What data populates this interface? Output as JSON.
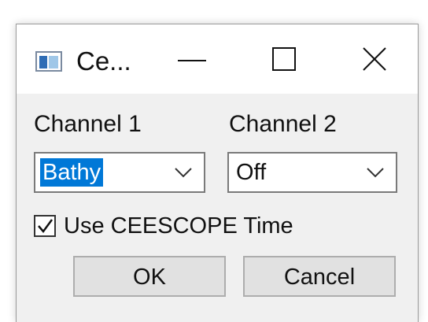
{
  "window": {
    "title": "Ce...",
    "app_icon": "window-app-icon",
    "controls": {
      "minimize_icon": "minimize-icon",
      "maximize_icon": "maximize-icon",
      "close_icon": "close-icon"
    }
  },
  "channel1": {
    "label": "Channel 1",
    "selected": "Bathy"
  },
  "channel2": {
    "label": "Channel 2",
    "selected": "Off"
  },
  "use_time": {
    "label": "Use CEESCOPE Time",
    "checked": true
  },
  "buttons": {
    "ok": "OK",
    "cancel": "Cancel"
  },
  "colors": {
    "selection_highlight": "#0078d7",
    "dialog_background": "#f0f0f0",
    "titlebar_background": "#ffffff",
    "button_face": "#e1e1e1"
  }
}
